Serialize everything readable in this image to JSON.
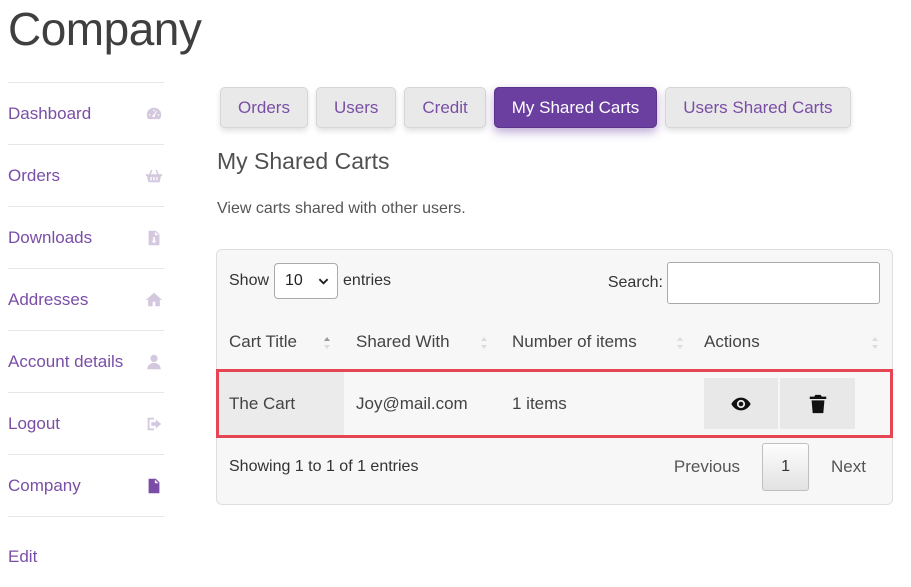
{
  "page": {
    "title": "Company"
  },
  "sidebar": {
    "items": [
      {
        "label": "Dashboard",
        "icon": "dashboard-icon"
      },
      {
        "label": "Orders",
        "icon": "basket-icon"
      },
      {
        "label": "Downloads",
        "icon": "file-download-icon"
      },
      {
        "label": "Addresses",
        "icon": "home-icon"
      },
      {
        "label": "Account details",
        "icon": "user-icon"
      },
      {
        "label": "Logout",
        "icon": "sign-out-icon"
      },
      {
        "label": "Company",
        "icon": "file-text-icon",
        "active": true
      }
    ],
    "edit_label": "Edit"
  },
  "tabs": [
    {
      "label": "Orders"
    },
    {
      "label": "Users"
    },
    {
      "label": "Credit"
    },
    {
      "label": "My Shared Carts",
      "active": true
    },
    {
      "label": "Users Shared Carts"
    }
  ],
  "section": {
    "title": "My Shared Carts",
    "description": "View carts shared with other users."
  },
  "table": {
    "length_prefix": "Show",
    "length_value": "10",
    "length_suffix": "entries",
    "search_label": "Search:",
    "search_value": "",
    "columns": [
      "Cart Title",
      "Shared With",
      "Number of items",
      "Actions"
    ],
    "rows": [
      {
        "cart_title": "The Cart",
        "shared_with": "Joy@mail.com",
        "items": "1 items",
        "actions": [
          "view-icon",
          "trash-icon"
        ]
      }
    ],
    "info": "Showing 1 to 1 of 1 entries",
    "pagination": {
      "previous": "Previous",
      "current": "1",
      "next": "Next"
    }
  },
  "colors": {
    "accent": "#7a4ea6",
    "active_tab": "#6b3fa0",
    "highlight_border": "#e64553"
  }
}
